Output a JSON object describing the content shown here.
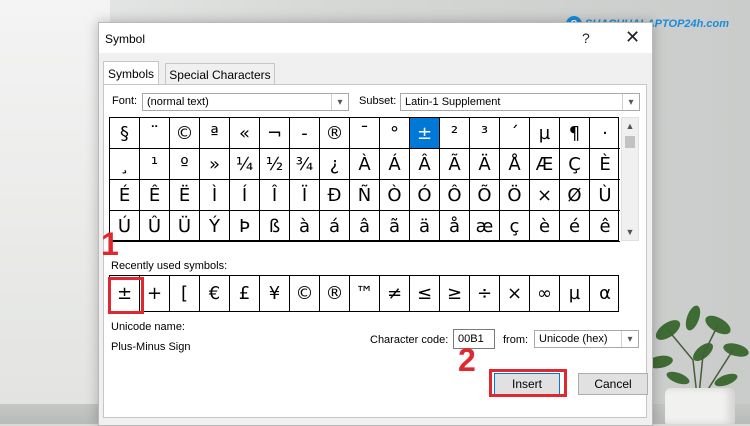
{
  "brand": {
    "mark": "S",
    "text": "SUACHUALAPTOP24h.com"
  },
  "dialog": {
    "title": "Symbol",
    "help": "?",
    "close": "✕",
    "tabs": [
      "Symbols",
      "Special Characters"
    ],
    "font_label": "Font:",
    "font_value": "(normal text)",
    "subset_label": "Subset:",
    "subset_value": "Latin-1 Supplement",
    "symbols": [
      "§",
      "¨",
      "©",
      "ª",
      "«",
      "¬",
      "-",
      "®",
      "¯",
      "°",
      "±",
      "²",
      "³",
      "´",
      "µ",
      "¶",
      "·",
      "¸",
      "¹",
      "º",
      "»",
      "¼",
      "½",
      "¾",
      "¿",
      "À",
      "Á",
      "Â",
      "Ã",
      "Ä",
      "Å",
      "Æ",
      "Ç",
      "È",
      "É",
      "Ê",
      "Ë",
      "Ì",
      "Í",
      "Î",
      "Ï",
      "Ð",
      "Ñ",
      "Ò",
      "Ó",
      "Ô",
      "Õ",
      "Ö",
      "×",
      "Ø",
      "Ù",
      "Ú",
      "Û",
      "Ü",
      "Ý",
      "Þ",
      "ß",
      "à",
      "á",
      "â",
      "ã",
      "ä",
      "å",
      "æ",
      "ç",
      "è",
      "é",
      "ê"
    ],
    "selected_symbol": "±",
    "recent_label": "Recently used symbols:",
    "recent": [
      "±",
      "+",
      "[",
      "€",
      "£",
      "¥",
      "©",
      "®",
      "™",
      "≠",
      "≤",
      "≥",
      "÷",
      "×",
      "∞",
      "µ",
      "α"
    ],
    "unicode_name_label": "Unicode name:",
    "unicode_name": "Plus-Minus Sign",
    "char_code_label": "Character code:",
    "char_code": "00B1",
    "from_label": "from:",
    "from_value": "Unicode (hex)",
    "insert_label": "Insert",
    "cancel_label": "Cancel"
  },
  "annotations": {
    "step1": "1",
    "step2": "2",
    "color": "#e0282e"
  },
  "colors": {
    "selected": "#0078d7",
    "brand": "#1a8cd8"
  }
}
